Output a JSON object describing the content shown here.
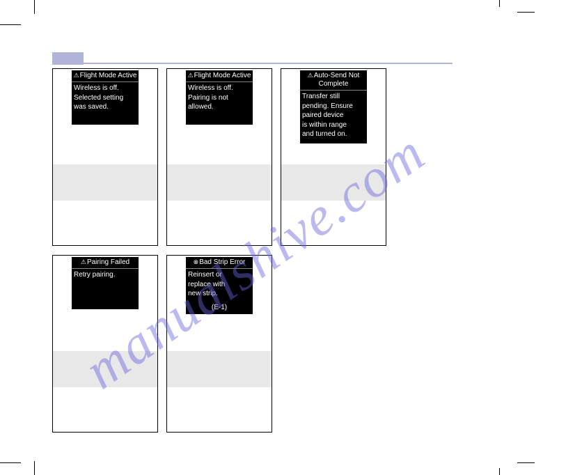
{
  "watermark": "manualshive.com",
  "row1": [
    {
      "title": "Flight Mode\nActive",
      "icon": "warn",
      "body": "Wireless is off.\nSelected setting\nwas saved.",
      "code": ""
    },
    {
      "title": "Flight Mode\nActive",
      "icon": "warn",
      "body": "Wireless is off.\nPairing is not\nallowed.",
      "code": ""
    },
    {
      "title": "Auto-Send\nNot Complete",
      "icon": "warn",
      "body": "Transfer still\npending. Ensure\npaired device\nis within range\nand turned on.",
      "code": ""
    }
  ],
  "row2": [
    {
      "title": "Pairing Failed",
      "icon": "warn",
      "body": "Retry pairing.",
      "code": ""
    },
    {
      "title": "Bad Strip\nError",
      "icon": "x",
      "body": "Reinsert or\nreplace with\nnew strip.",
      "code": "(E-1)"
    }
  ]
}
